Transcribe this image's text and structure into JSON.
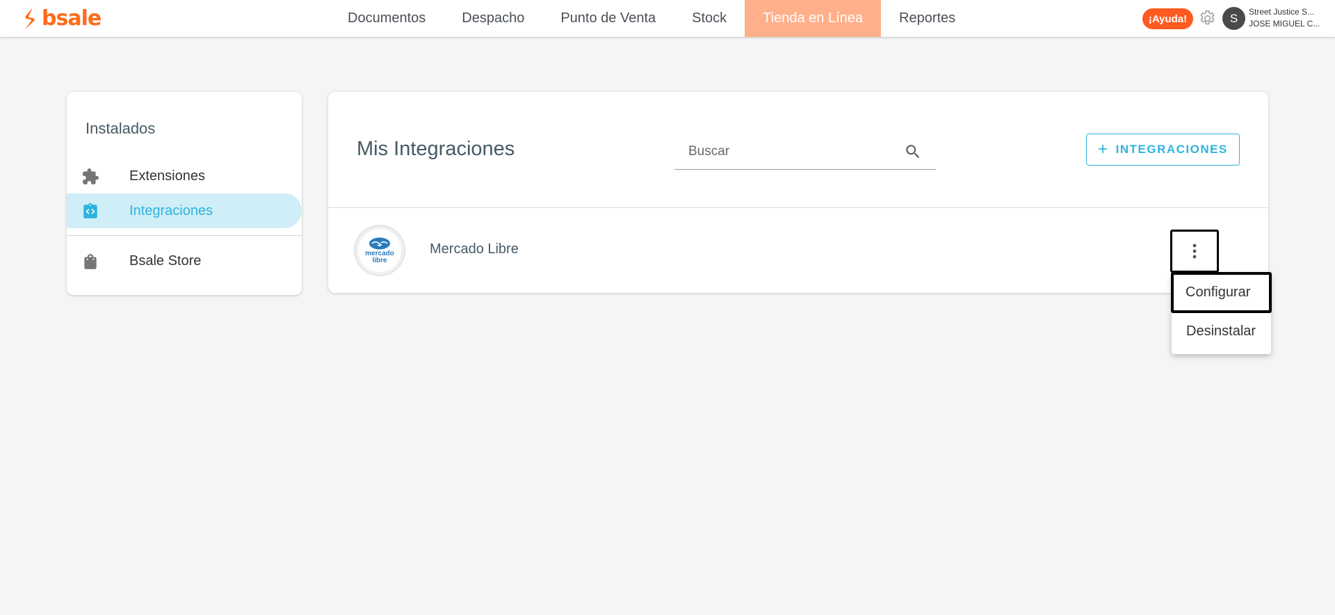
{
  "brand": {
    "name": "bsale",
    "color": "#ff6b1a"
  },
  "nav": {
    "items": [
      {
        "label": "Documentos",
        "active": false
      },
      {
        "label": "Despacho",
        "active": false
      },
      {
        "label": "Punto de Venta",
        "active": false
      },
      {
        "label": "Stock",
        "active": false
      },
      {
        "label": "Tienda en Línea",
        "active": true
      },
      {
        "label": "Reportes",
        "active": false
      }
    ],
    "active_color": "#ffb08a"
  },
  "header": {
    "help_label": "¡Ayuda!",
    "help_color": "#ff5a1f",
    "avatar_initial": "S",
    "company": "Street Justice S...",
    "user": "JOSE MIGUEL C..."
  },
  "sidebar": {
    "title": "Instalados",
    "items": [
      {
        "label": "Extensiones",
        "icon": "puzzle-icon",
        "active": false
      },
      {
        "label": "Integraciones",
        "icon": "code-box-icon",
        "active": true
      },
      {
        "label": "Bsale Store",
        "icon": "shopping-bag-icon",
        "active": false
      }
    ],
    "accent": "#2db4de"
  },
  "main": {
    "title": "Mis Integraciones",
    "search": {
      "placeholder": "Buscar",
      "value": ""
    },
    "add_button_label": "INTEGRACIONES",
    "integrations": [
      {
        "name": "Mercado Libre",
        "logo_text_1": "mercado",
        "logo_text_2": "libre"
      }
    ]
  },
  "menu": {
    "items": [
      {
        "label": "Configurar",
        "focused": true
      },
      {
        "label": "Desinstalar",
        "focused": false
      }
    ]
  }
}
